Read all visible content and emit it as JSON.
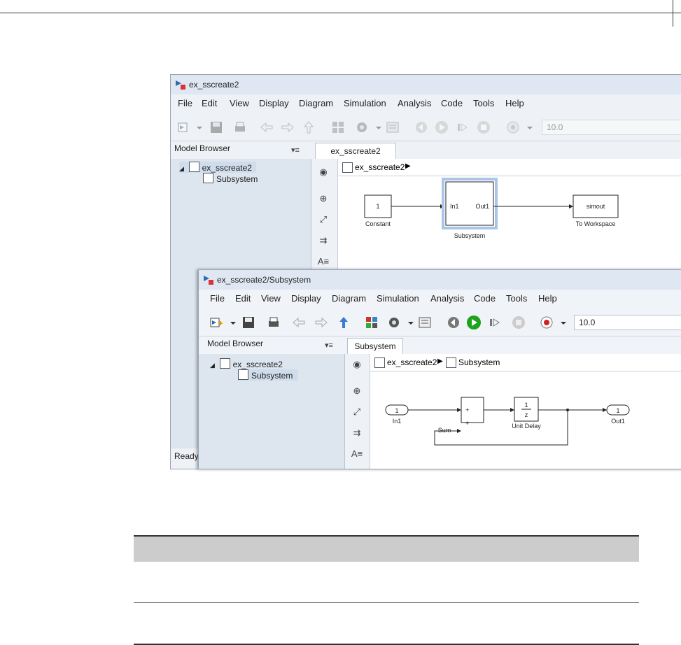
{
  "back_window": {
    "title": "ex_sscreate2",
    "menu": [
      "File",
      "Edit",
      "View",
      "Display",
      "Diagram",
      "Simulation",
      "Analysis",
      "Code",
      "Tools",
      "Help"
    ],
    "stop_time": "10.0",
    "browser_label": "Model Browser",
    "tab_label": "ex_sscreate2",
    "tree": [
      "ex_sscreate2",
      "Subsystem"
    ],
    "breadcrumb": [
      "ex_sscreate2"
    ],
    "status": "Ready",
    "blocks": {
      "constant_value": "1",
      "constant_label": "Constant",
      "subsystem_in": "In1",
      "subsystem_out": "Out1",
      "subsystem_label": "Subsystem",
      "workspace_value": "simout",
      "workspace_label": "To Workspace"
    }
  },
  "front_window": {
    "title": "ex_sscreate2/Subsystem",
    "menu": [
      "File",
      "Edit",
      "View",
      "Display",
      "Diagram",
      "Simulation",
      "Analysis",
      "Code",
      "Tools",
      "Help"
    ],
    "stop_time": "10.0",
    "browser_label": "Model Browser",
    "tab_label": "Subsystem",
    "tree": [
      "ex_sscreate2",
      "Subsystem"
    ],
    "breadcrumb": [
      "ex_sscreate2",
      "Subsystem"
    ],
    "blocks": {
      "in_port": "1",
      "in_label": "In1",
      "sum_plus1": "+",
      "sum_plus2": "+",
      "sum_label": "Sum",
      "delay_num": "1",
      "delay_den": "z",
      "delay_label": "Unit Delay",
      "out_port": "1",
      "out_label": "Out1"
    }
  },
  "colors": {
    "browser_panel": "#dde5ee",
    "selection_blue": "#a9c6e8",
    "run_green": "#1ea31e",
    "record_red": "#d42020"
  }
}
